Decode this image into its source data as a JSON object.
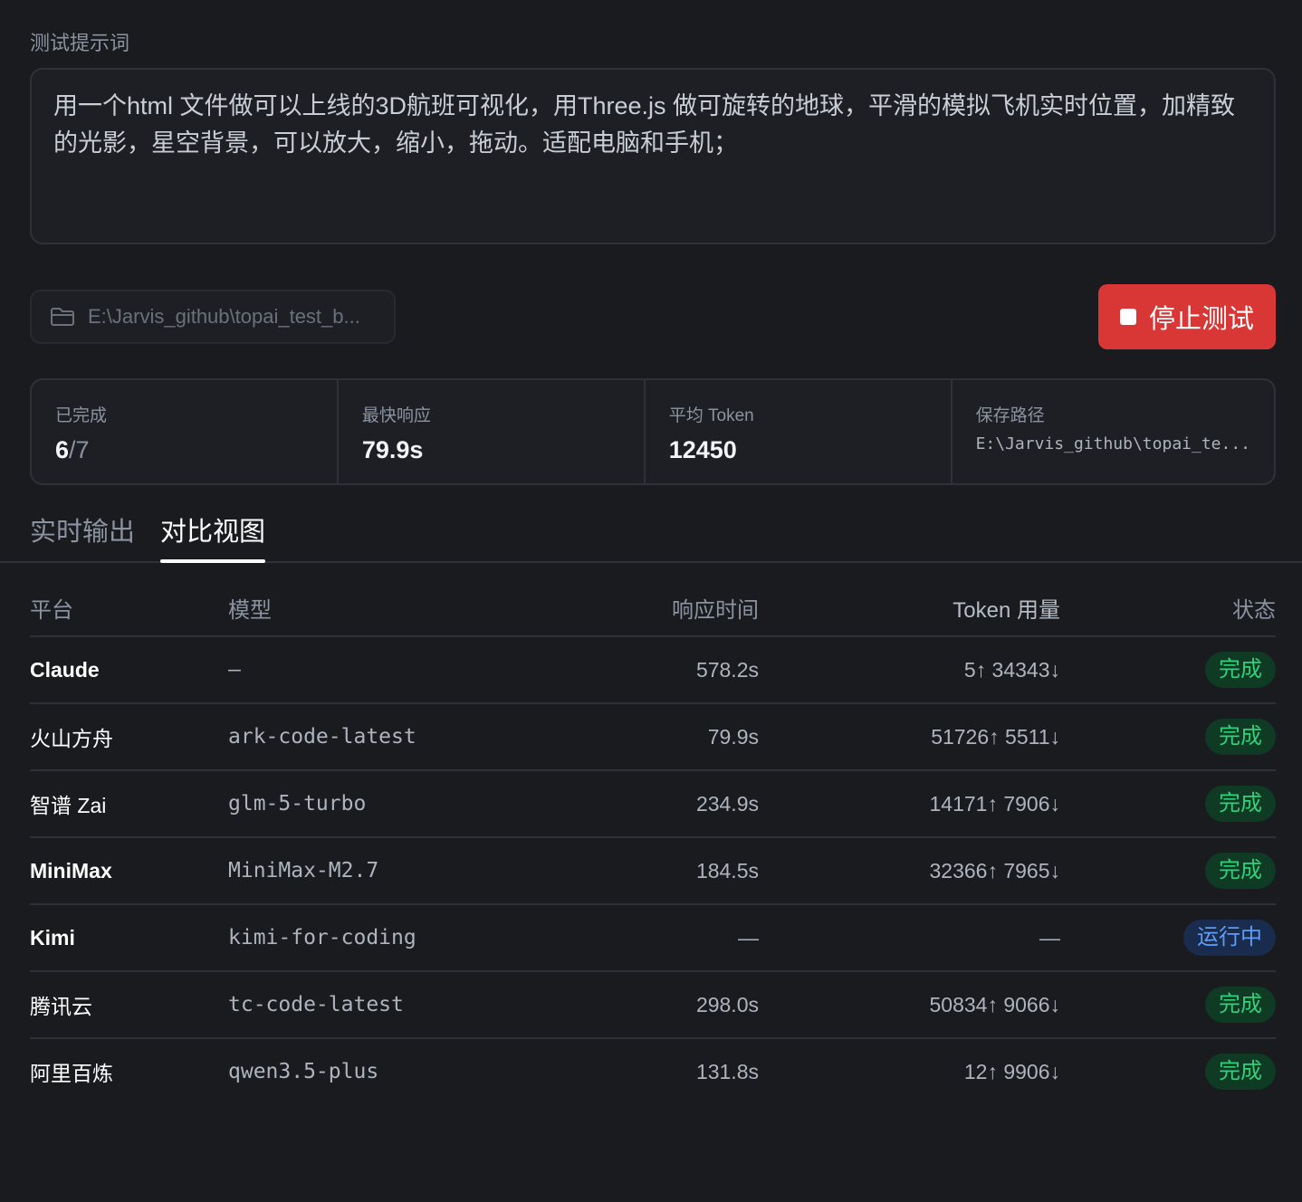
{
  "prompt": {
    "label": "测试提示词",
    "text": "用一个html 文件做可以上线的3D航班可视化，用Three.js 做可旋转的地球，平滑的模拟飞机实时位置，加精致的光影，星空背景，可以放大，缩小，拖动。适配电脑和手机；"
  },
  "output_path": "E:\\Jarvis_github\\topai_test_b...",
  "stop_button": {
    "label": "停止测试",
    "color": "#d93636"
  },
  "stats": {
    "completed": {
      "label": "已完成",
      "done": "6",
      "total": "/7"
    },
    "fastest": {
      "label": "最快响应",
      "value": "79.9s"
    },
    "avg_token": {
      "label": "平均 Token",
      "value": "12450"
    },
    "save_path": {
      "label": "保存路径",
      "value": "E:\\Jarvis_github\\topai_te..."
    }
  },
  "tabs": [
    {
      "label": "实时输出",
      "active": false
    },
    {
      "label": "对比视图",
      "active": true
    }
  ],
  "table": {
    "headers": {
      "platform": "平台",
      "model": "模型",
      "time": "响应时间",
      "token": "Token 用量",
      "status": "状态"
    },
    "rows": [
      {
        "platform": "Claude",
        "model": "–",
        "time": "578.2s",
        "token": "5↑ 34343↓",
        "status": "完成",
        "state": "done"
      },
      {
        "platform": "火山方舟",
        "model": "ark-code-latest",
        "time": "79.9s",
        "token": "51726↑ 5511↓",
        "status": "完成",
        "state": "done"
      },
      {
        "platform": "智谱 Zai",
        "model": "glm-5-turbo",
        "time": "234.9s",
        "token": "14171↑ 7906↓",
        "status": "完成",
        "state": "done"
      },
      {
        "platform": "MiniMax",
        "model": "MiniMax-M2.7",
        "time": "184.5s",
        "token": "32366↑ 7965↓",
        "status": "完成",
        "state": "done"
      },
      {
        "platform": "Kimi",
        "model": "kimi-for-coding",
        "time": "—",
        "token": "—",
        "status": "运行中",
        "state": "running"
      },
      {
        "platform": "腾讯云",
        "model": "tc-code-latest",
        "time": "298.0s",
        "token": "50834↑ 9066↓",
        "status": "完成",
        "state": "done"
      },
      {
        "platform": "阿里百炼",
        "model": "qwen3.5-plus",
        "time": "131.8s",
        "token": "12↑ 9906↓",
        "status": "完成",
        "state": "done"
      }
    ]
  },
  "colors": {
    "background": "#1a1b1f",
    "status_done": "#2fd17a",
    "status_running": "#5e9cf5"
  }
}
